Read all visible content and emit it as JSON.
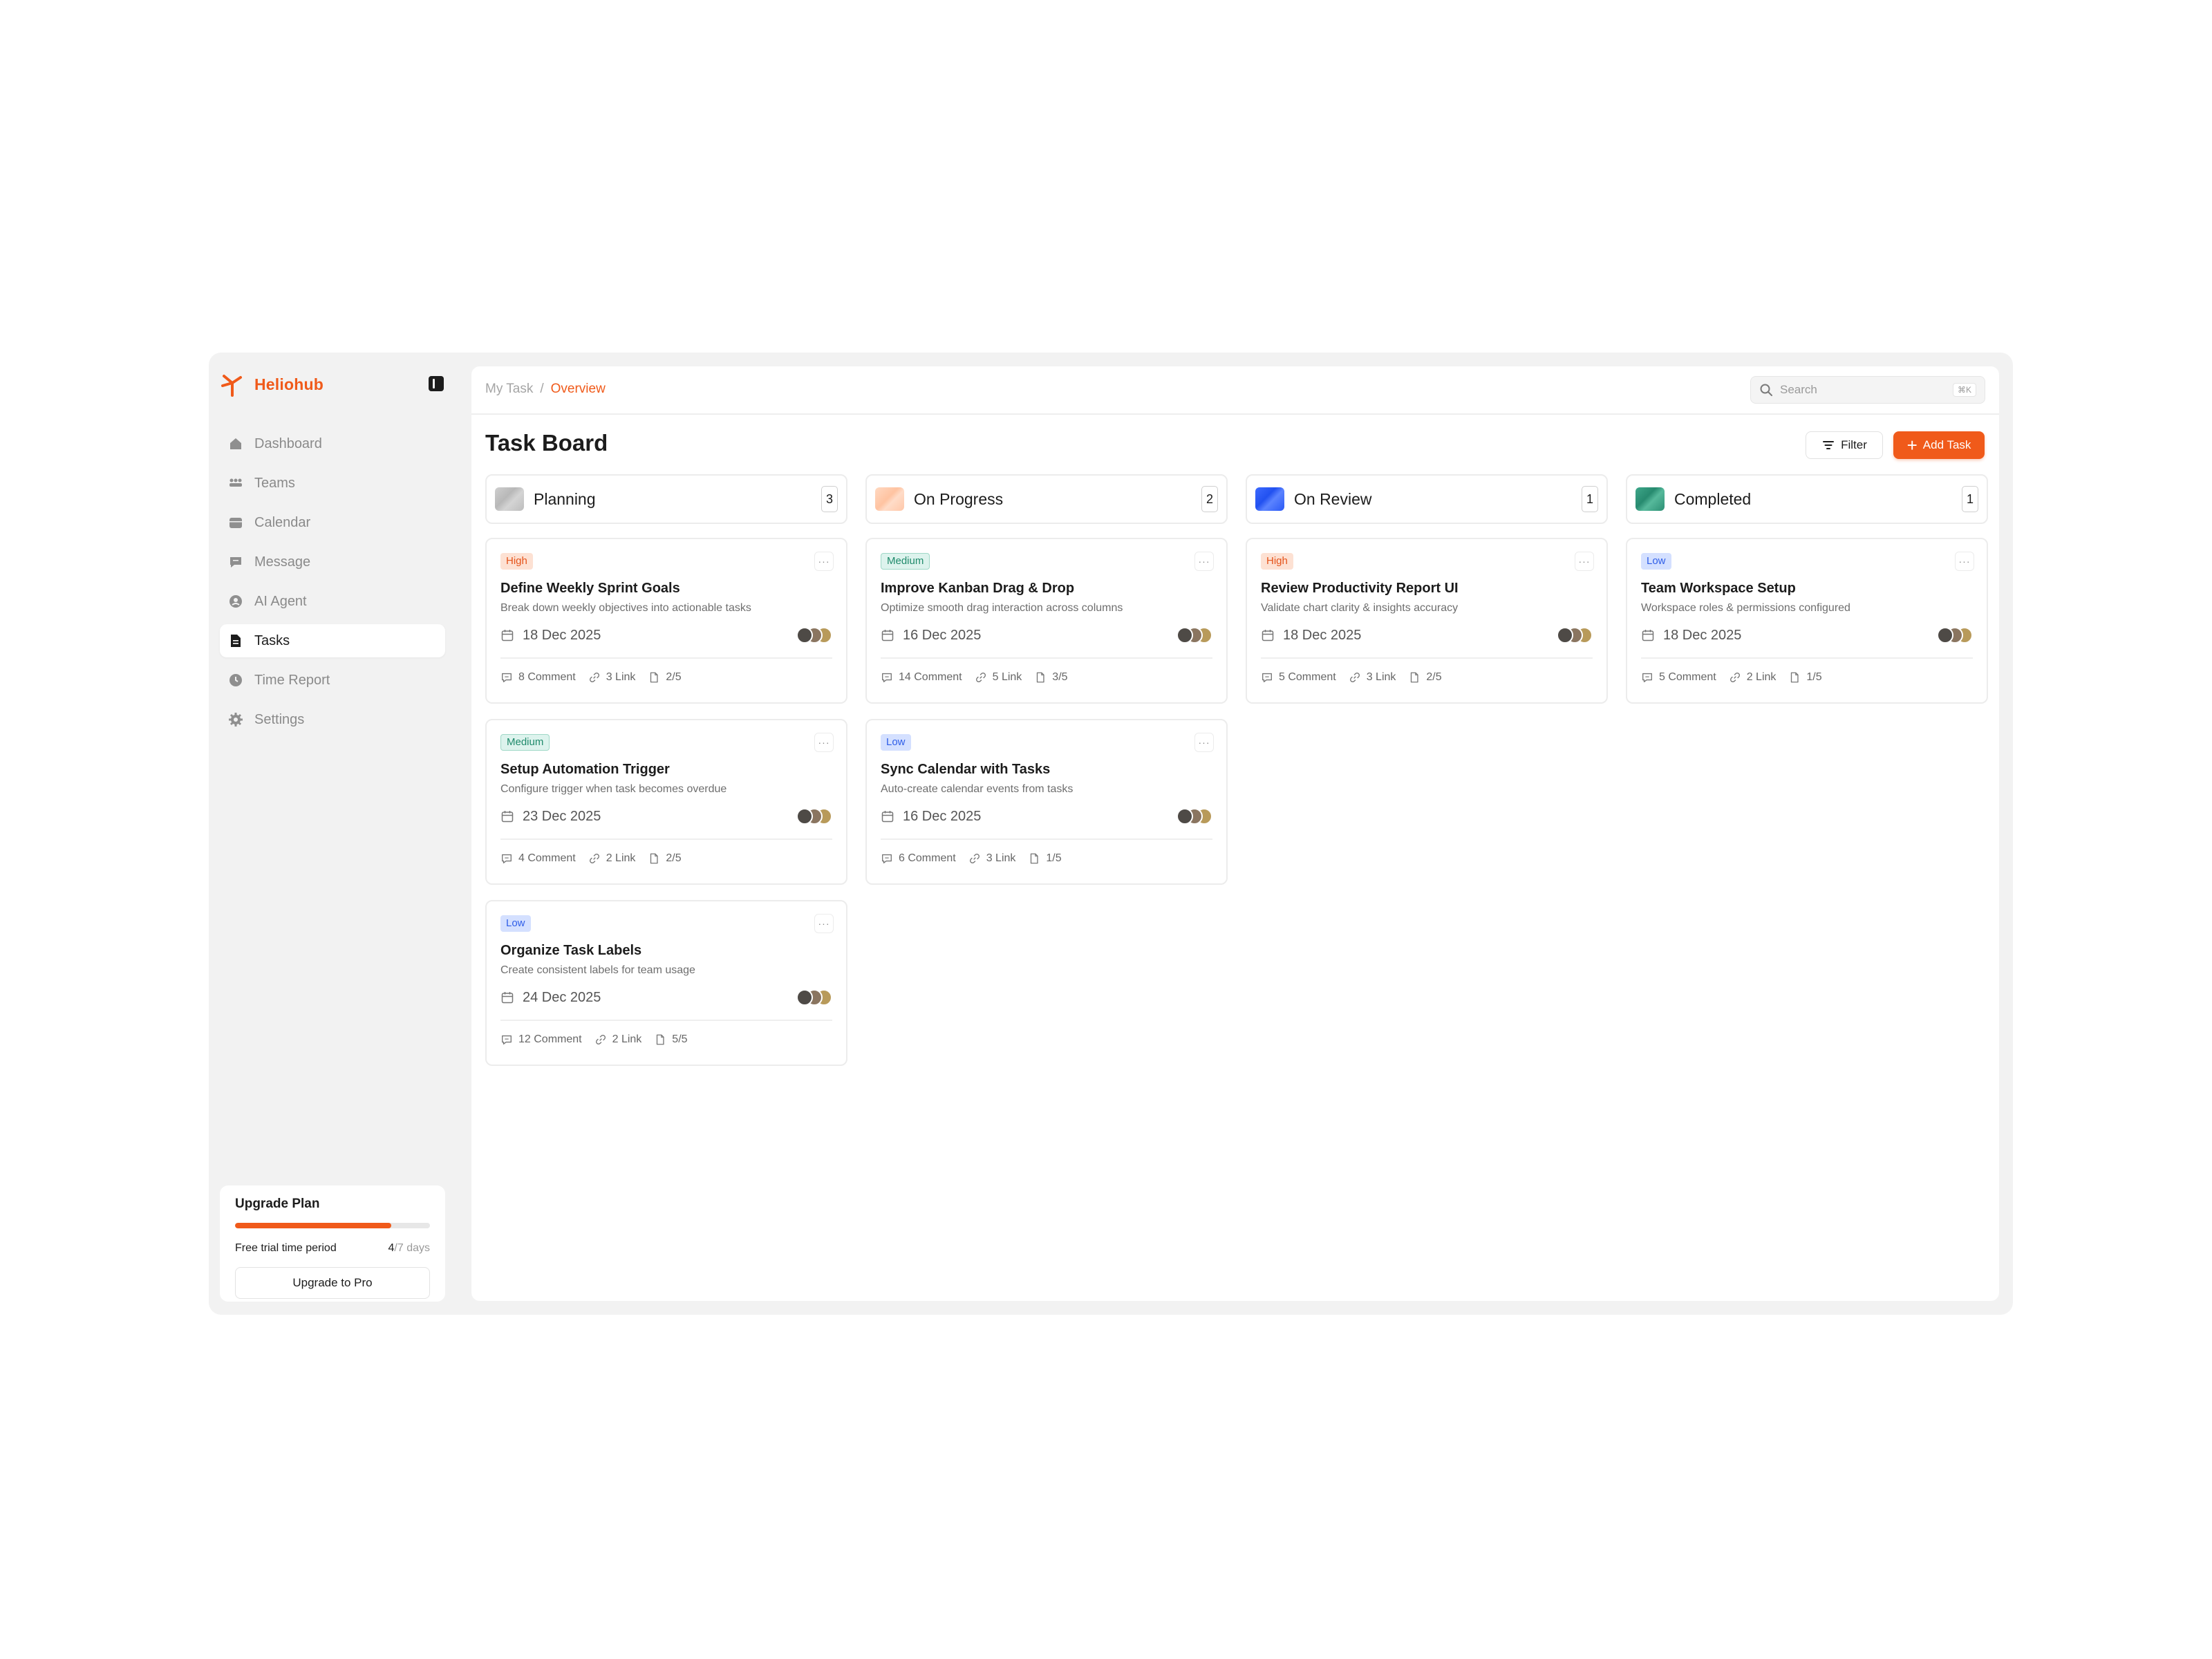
{
  "app": {
    "name": "Heliohub",
    "accent": "#f05a1a"
  },
  "sidebar": {
    "items": [
      {
        "label": "Dashboard",
        "icon": "home-icon"
      },
      {
        "label": "Teams",
        "icon": "team-icon"
      },
      {
        "label": "Calendar",
        "icon": "calendar-icon"
      },
      {
        "label": "Message",
        "icon": "message-icon"
      },
      {
        "label": "AI Agent",
        "icon": "ai-agent-icon"
      },
      {
        "label": "Tasks",
        "icon": "tasks-icon",
        "active": true
      },
      {
        "label": "Time Report",
        "icon": "clock-icon"
      },
      {
        "label": "Settings",
        "icon": "gear-icon"
      }
    ],
    "upgrade": {
      "title": "Upgrade Plan",
      "trial_label": "Free trial time period",
      "days_used": "4",
      "days_total": "/7 days",
      "progress": 0.8,
      "button": "Upgrade to Pro"
    }
  },
  "header": {
    "breadcrumb_parent": "My Task",
    "breadcrumb_sep": "/",
    "breadcrumb_current": "Overview",
    "search_placeholder": "Search",
    "search_shortcut": "⌘K"
  },
  "board": {
    "title": "Task Board",
    "filter_label": "Filter",
    "add_label": "Add Task",
    "columns": [
      {
        "title": "Planning",
        "count": "3",
        "swatch": "planning",
        "cards": [
          {
            "priority": "High",
            "level": "high",
            "title": "Define Weekly Sprint Goals",
            "desc": "Break down weekly objectives into actionable tasks",
            "date": "18 Dec 2025",
            "comments": "8 Comment",
            "links": "3 Link",
            "files": "2/5"
          },
          {
            "priority": "Medium",
            "level": "medium",
            "title": "Setup Automation Trigger",
            "desc": "Configure trigger when task becomes overdue",
            "date": "23 Dec 2025",
            "comments": "4 Comment",
            "links": "2 Link",
            "files": "2/5"
          },
          {
            "priority": "Low",
            "level": "low",
            "title": "Organize Task Labels",
            "desc": "Create consistent labels for team usage",
            "date": "24 Dec 2025",
            "comments": "12 Comment",
            "links": "2 Link",
            "files": "5/5"
          }
        ]
      },
      {
        "title": "On Progress",
        "count": "2",
        "swatch": "progress",
        "cards": [
          {
            "priority": "Medium",
            "level": "medium",
            "title": "Improve Kanban Drag & Drop",
            "desc": "Optimize smooth drag interaction across columns",
            "date": "16 Dec 2025",
            "comments": "14 Comment",
            "links": "5 Link",
            "files": "3/5"
          },
          {
            "priority": "Low",
            "level": "low",
            "title": "Sync Calendar with Tasks",
            "desc": "Auto-create calendar events from tasks",
            "date": "16 Dec 2025",
            "comments": "6 Comment",
            "links": "3 Link",
            "files": "1/5"
          }
        ]
      },
      {
        "title": "On Review",
        "count": "1",
        "swatch": "review",
        "cards": [
          {
            "priority": "High",
            "level": "high",
            "title": "Review Productivity Report UI",
            "desc": "Validate chart clarity & insights accuracy",
            "date": "18 Dec 2025",
            "comments": "5 Comment",
            "links": "3 Link",
            "files": "2/5"
          }
        ]
      },
      {
        "title": "Completed",
        "count": "1",
        "swatch": "completed",
        "cards": [
          {
            "priority": "Low",
            "level": "low",
            "title": "Team Workspace Setup",
            "desc": "Workspace roles & permissions configured",
            "date": "18 Dec 2025",
            "comments": "5 Comment",
            "links": "2 Link",
            "files": "1/5"
          }
        ]
      }
    ]
  }
}
